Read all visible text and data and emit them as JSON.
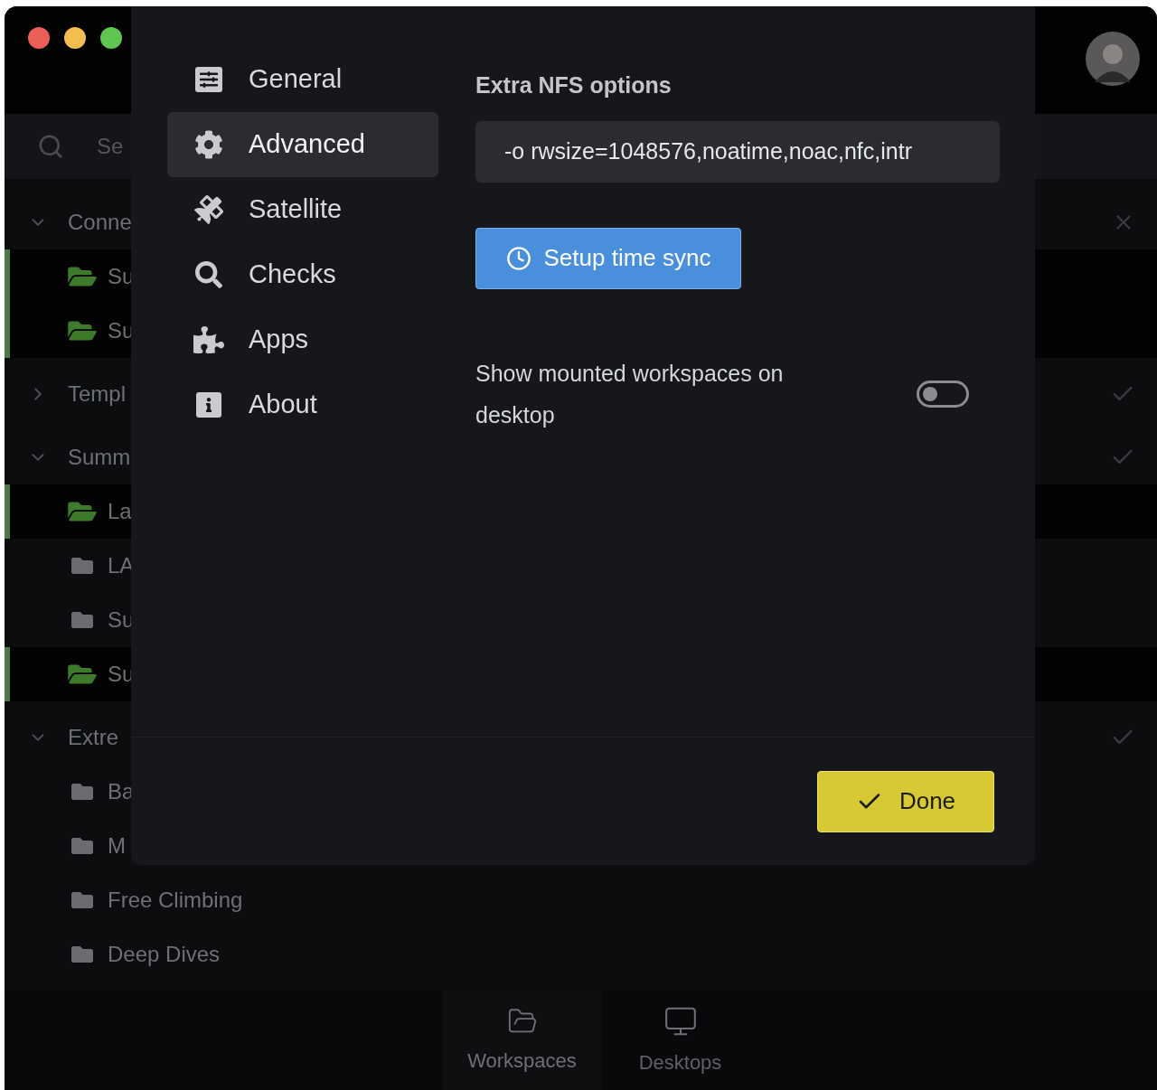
{
  "window": {
    "traffic_lights": [
      {
        "color": "#ec5f57"
      },
      {
        "color": "#f4bd4f"
      },
      {
        "color": "#5fc553"
      }
    ]
  },
  "search": {
    "placeholder": "Se"
  },
  "tree": [
    {
      "label": "Conne",
      "expanded": true,
      "error": true,
      "children": [
        {
          "label": "Su",
          "active": true
        },
        {
          "label": "Su",
          "active": true
        }
      ]
    },
    {
      "label": "Templ",
      "expanded": false,
      "error": false
    },
    {
      "label": "Summ",
      "expanded": true,
      "error": false,
      "children": [
        {
          "label": "La",
          "active": true
        },
        {
          "label": "LA",
          "active": false
        },
        {
          "label": "Su",
          "active": false
        },
        {
          "label": "Su",
          "active": true
        }
      ]
    },
    {
      "label": "Extre",
      "expanded": true,
      "error": false,
      "children": [
        {
          "label": "Ba",
          "active": false
        },
        {
          "label": "M",
          "active": false
        },
        {
          "label": "Free Climbing",
          "active": false
        },
        {
          "label": "Deep Dives",
          "active": false
        }
      ]
    }
  ],
  "bottom_tabs": [
    {
      "label": "Workspaces",
      "selected": true
    },
    {
      "label": "Desktops",
      "selected": false
    }
  ],
  "settings": {
    "nav": [
      {
        "label": "General",
        "selected": false
      },
      {
        "label": "Advanced",
        "selected": true
      },
      {
        "label": "Satellite",
        "selected": false
      },
      {
        "label": "Checks",
        "selected": false
      },
      {
        "label": "Apps",
        "selected": false
      },
      {
        "label": "About",
        "selected": false
      }
    ],
    "nfs": {
      "label": "Extra NFS options",
      "value": "-o rwsize=1048576,noatime,noac,nfc,intr"
    },
    "time_sync_button": "Setup time sync",
    "toggle": {
      "label": "Show mounted workspaces on desktop",
      "on": false
    },
    "done_button": "Done"
  }
}
